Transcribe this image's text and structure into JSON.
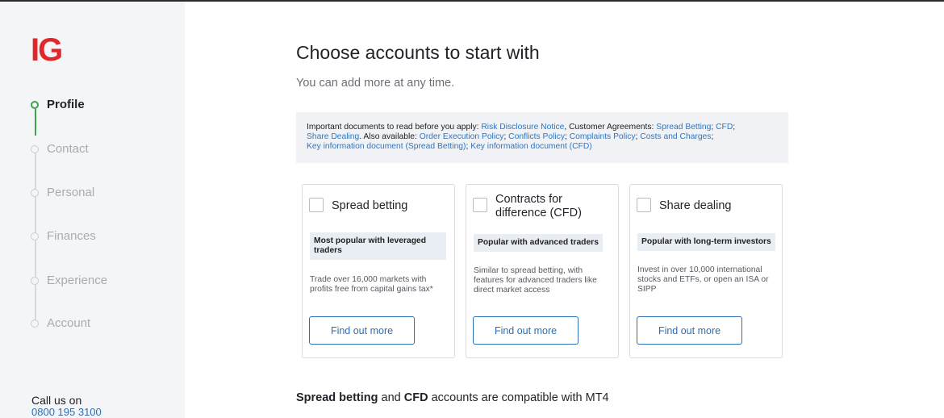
{
  "brand": {
    "logo_text": "IG",
    "logo_color": "#e0282b"
  },
  "steps": [
    {
      "label": "Profile",
      "state": "active"
    },
    {
      "label": "Contact",
      "state": "pending"
    },
    {
      "label": "Personal",
      "state": "pending"
    },
    {
      "label": "Finances",
      "state": "pending"
    },
    {
      "label": "Experience",
      "state": "pending"
    },
    {
      "label": "Account",
      "state": "pending"
    }
  ],
  "contact": {
    "call_label": "Call us on",
    "phone": "0800 195 3100"
  },
  "header": {
    "title": "Choose accounts to start with",
    "subtitle": "You can add more at any time."
  },
  "notice": {
    "intro": "Important documents to read before you apply: ",
    "risk_link": "Risk Disclosure Notice",
    "sep1": ", Customer Agreements: ",
    "spread_link": "Spread Betting",
    "sep2": "; ",
    "cfd_link": "CFD",
    "sep3": ";",
    "share_link": "Share Dealing",
    "sep4": ". Also available: ",
    "order_link": "Order Execution Policy",
    "sep5": "; ",
    "conflicts_link": "Conflicts Policy",
    "sep6": "; ",
    "complaints_link": "Complaints Policy",
    "sep7": "; ",
    "costs_link": "Costs and Charges",
    "sep8": ";",
    "kid_spread_link": "Key information document (Spread Betting)",
    "sep9": "; ",
    "kid_cfd_link": "Key information document (CFD)"
  },
  "accounts": [
    {
      "title": "Spread betting",
      "tag": "Most popular with leveraged traders",
      "description": "Trade over 16,000 markets with profits free from capital gains tax*",
      "button": "Find out more",
      "checked": false
    },
    {
      "title": "Contracts for difference (CFD)",
      "tag": "Popular with advanced traders",
      "description": "Similar to spread betting, with features for advanced traders like direct market access",
      "button": "Find out more",
      "checked": false
    },
    {
      "title": "Share dealing",
      "tag": "Popular with long-term investors",
      "description": "Invest in over 10,000 international stocks and ETFs, or open an ISA or SIPP",
      "button": "Find out more",
      "checked": false
    }
  ],
  "mt4": {
    "part1": "Spread betting",
    "part2": " and ",
    "part3": "CFD",
    "part4": " accounts are compatible with MT4"
  },
  "colors": {
    "accent": "#2a6fb5",
    "link": "#2a77c4",
    "step_active": "#3fa34d"
  }
}
